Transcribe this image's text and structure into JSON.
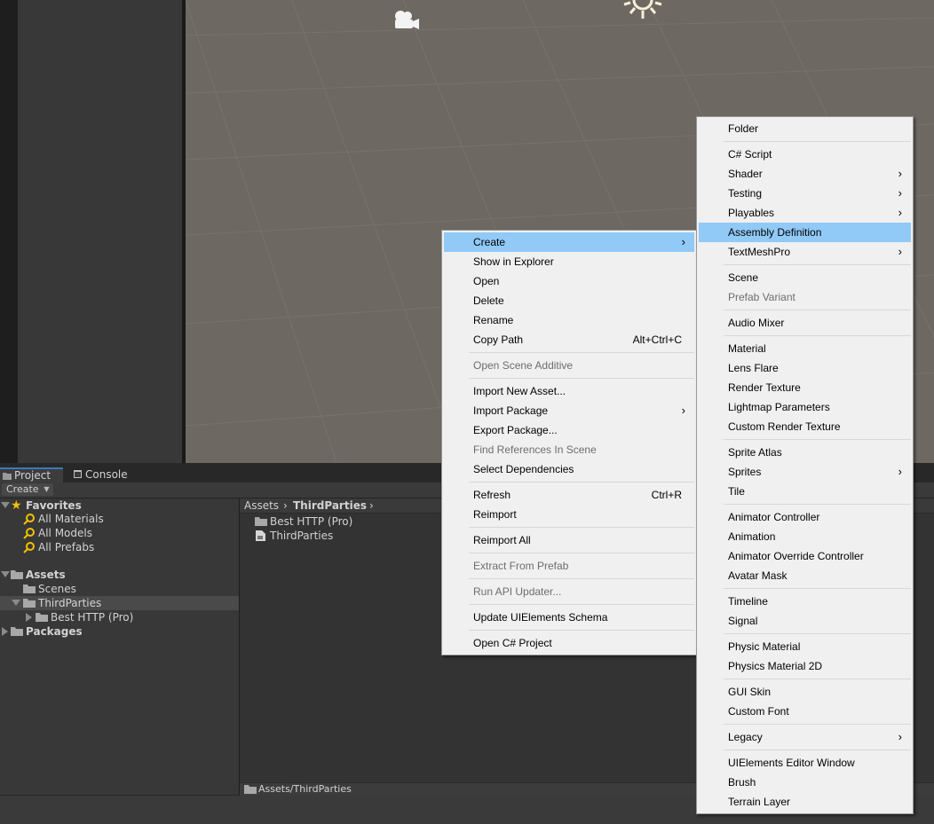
{
  "project_window": {
    "tabs": [
      {
        "label": "Project"
      },
      {
        "label": "Console"
      }
    ],
    "create_label": "Create",
    "tree": {
      "favorites": "Favorites",
      "favorite_items": [
        "All Materials",
        "All Models",
        "All Prefabs"
      ],
      "assets": "Assets",
      "assets_children": [
        "Scenes",
        "ThirdParties"
      ],
      "third_parties_children": [
        "Best HTTP (Pro)"
      ],
      "packages": "Packages"
    },
    "breadcrumb": {
      "root": "Assets",
      "current": "ThirdParties",
      "sep": "›"
    },
    "asset_items": [
      "Best HTTP (Pro)",
      "ThirdParties"
    ],
    "path_bar": "Assets/ThirdParties"
  },
  "context_menu": {
    "create": "Create",
    "show_in_explorer": "Show in Explorer",
    "open": "Open",
    "delete": "Delete",
    "rename": "Rename",
    "copy_path": "Copy Path",
    "copy_path_shortcut": "Alt+Ctrl+C",
    "open_scene_additive": "Open Scene Additive",
    "import_new_asset": "Import New Asset...",
    "import_package": "Import Package",
    "export_package": "Export Package...",
    "find_references": "Find References In Scene",
    "select_dependencies": "Select Dependencies",
    "refresh": "Refresh",
    "refresh_shortcut": "Ctrl+R",
    "reimport": "Reimport",
    "reimport_all": "Reimport All",
    "extract_from_prefab": "Extract From Prefab",
    "run_api_updater": "Run API Updater...",
    "update_uielements_schema": "Update UIElements Schema",
    "open_csharp_project": "Open C# Project",
    "submenu_arrow": "›"
  },
  "create_submenu": {
    "folder": "Folder",
    "csharp_script": "C# Script",
    "shader": "Shader",
    "testing": "Testing",
    "playables": "Playables",
    "assembly_definition": "Assembly Definition",
    "textmeshpro": "TextMeshPro",
    "scene": "Scene",
    "prefab_variant": "Prefab Variant",
    "audio_mixer": "Audio Mixer",
    "material": "Material",
    "lens_flare": "Lens Flare",
    "render_texture": "Render Texture",
    "lightmap_parameters": "Lightmap Parameters",
    "custom_render_texture": "Custom Render Texture",
    "sprite_atlas": "Sprite Atlas",
    "sprites": "Sprites",
    "tile": "Tile",
    "animator_controller": "Animator Controller",
    "animation": "Animation",
    "animator_override_controller": "Animator Override Controller",
    "avatar_mask": "Avatar Mask",
    "timeline": "Timeline",
    "signal": "Signal",
    "physic_material": "Physic Material",
    "physics_material_2d": "Physics Material 2D",
    "gui_skin": "GUI Skin",
    "custom_font": "Custom Font",
    "legacy": "Legacy",
    "uielements_editor_window": "UIElements Editor Window",
    "brush": "Brush",
    "terrain_layer": "Terrain Layer"
  },
  "colors": {
    "scene_background": "#6e6863",
    "menu_background": "#f0f0f0",
    "menu_highlight": "#91c9f7",
    "tab_accent": "#3a79bb",
    "favorites_star": "#f2c200"
  }
}
